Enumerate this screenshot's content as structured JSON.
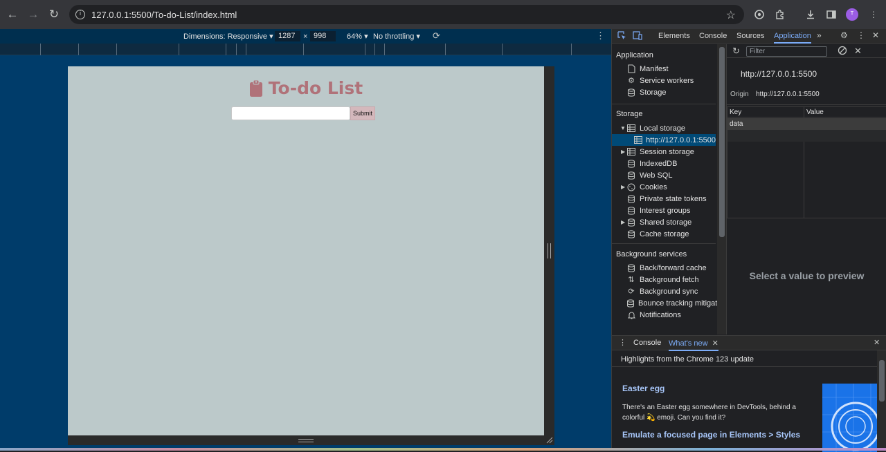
{
  "browser": {
    "url": "127.0.0.1:5500/To-do-List/index.html",
    "avatar_letter": "ᵀ"
  },
  "device_toolbar": {
    "dimensions_label": "Dimensions: Responsive",
    "width": "1287",
    "times": "×",
    "height": "998",
    "zoom": "64%",
    "throttling": "No throttling"
  },
  "page": {
    "title": "To-do List",
    "input_value": "",
    "submit_label": "Submit"
  },
  "devtools": {
    "tabs": [
      "Elements",
      "Console",
      "Sources",
      "Application"
    ],
    "active_tab": "Application",
    "sidebar": {
      "application_heading": "Application",
      "application_items": [
        "Manifest",
        "Service workers",
        "Storage"
      ],
      "storage_heading": "Storage",
      "storage_items": [
        "Local storage",
        "http://127.0.0.1:5500",
        "Session storage",
        "IndexedDB",
        "Web SQL",
        "Cookies",
        "Private state tokens",
        "Interest groups",
        "Shared storage",
        "Cache storage"
      ],
      "background_heading": "Background services",
      "background_items": [
        "Back/forward cache",
        "Background fetch",
        "Background sync",
        "Bounce tracking mitigatic",
        "Notifications"
      ]
    },
    "storage_panel": {
      "filter_placeholder": "Filter",
      "origin_url": "http://127.0.0.1:5500",
      "origin_label": "Origin",
      "origin_value": "http://127.0.0.1:5500",
      "columns": [
        "Key",
        "Value"
      ],
      "rows": [
        {
          "key": "data",
          "value": ""
        }
      ],
      "preview_text": "Select a value to preview"
    },
    "drawer": {
      "tabs": [
        "Console",
        "What's new"
      ],
      "active_tab": "What's new",
      "highlights": "Highlights from the Chrome 123 update",
      "easter_title": "Easter egg",
      "easter_text": "There's an Easter egg somewhere in DevTools, behind a colorful 💫 emoji. Can you find it?",
      "emulate_link": "Emulate a focused page in Elements > Styles"
    }
  },
  "colors": {
    "page_bg": "#bcc9ca",
    "title_color": "#b07279",
    "submit_bg": "#d4b8bc",
    "emulator_bg": "#003c6a",
    "devtools_accent": "#7cacf8"
  }
}
